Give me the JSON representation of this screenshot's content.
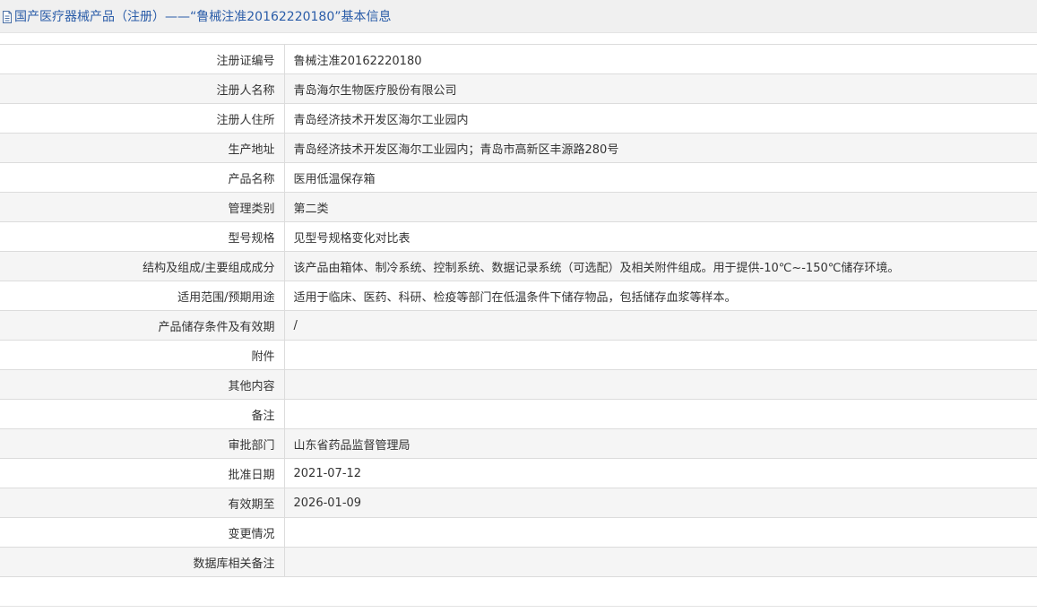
{
  "header": {
    "icon": "document-icon",
    "title": "国产医疗器械产品（注册）——“鲁械注准20162220180”基本信息",
    "title_color": "#2a5ca8",
    "background": "#f0f0f0"
  },
  "rows": [
    {
      "label": "注册证编号",
      "value": "鲁械注准20162220180"
    },
    {
      "label": "注册人名称",
      "value": "青岛海尔生物医疗股份有限公司"
    },
    {
      "label": "注册人住所",
      "value": "青岛经济技术开发区海尔工业园内"
    },
    {
      "label": "生产地址",
      "value": "青岛经济技术开发区海尔工业园内；青岛市高新区丰源路280号"
    },
    {
      "label": "产品名称",
      "value": "医用低温保存箱"
    },
    {
      "label": "管理类别",
      "value": "第二类"
    },
    {
      "label": "型号规格",
      "value": "见型号规格变化对比表"
    },
    {
      "label": "结构及组成/主要组成成分",
      "value": "该产品由箱体、制冷系统、控制系统、数据记录系统（可选配）及相关附件组成。用于提供-10℃~-150℃储存环境。"
    },
    {
      "label": "适用范围/预期用途",
      "value": "适用于临床、医药、科研、检疫等部门在低温条件下储存物品，包括储存血浆等样本。"
    },
    {
      "label": "产品储存条件及有效期",
      "value": "/"
    },
    {
      "label": "附件",
      "value": ""
    },
    {
      "label": "其他内容",
      "value": ""
    },
    {
      "label": "备注",
      "value": ""
    },
    {
      "label": "审批部门",
      "value": "山东省药品监督管理局"
    },
    {
      "label": "批准日期",
      "value": "2021-07-12"
    },
    {
      "label": "有效期至",
      "value": "2026-01-09"
    },
    {
      "label": "变更情况",
      "value": ""
    },
    {
      "label": "数据库相关备注",
      "value": ""
    }
  ]
}
